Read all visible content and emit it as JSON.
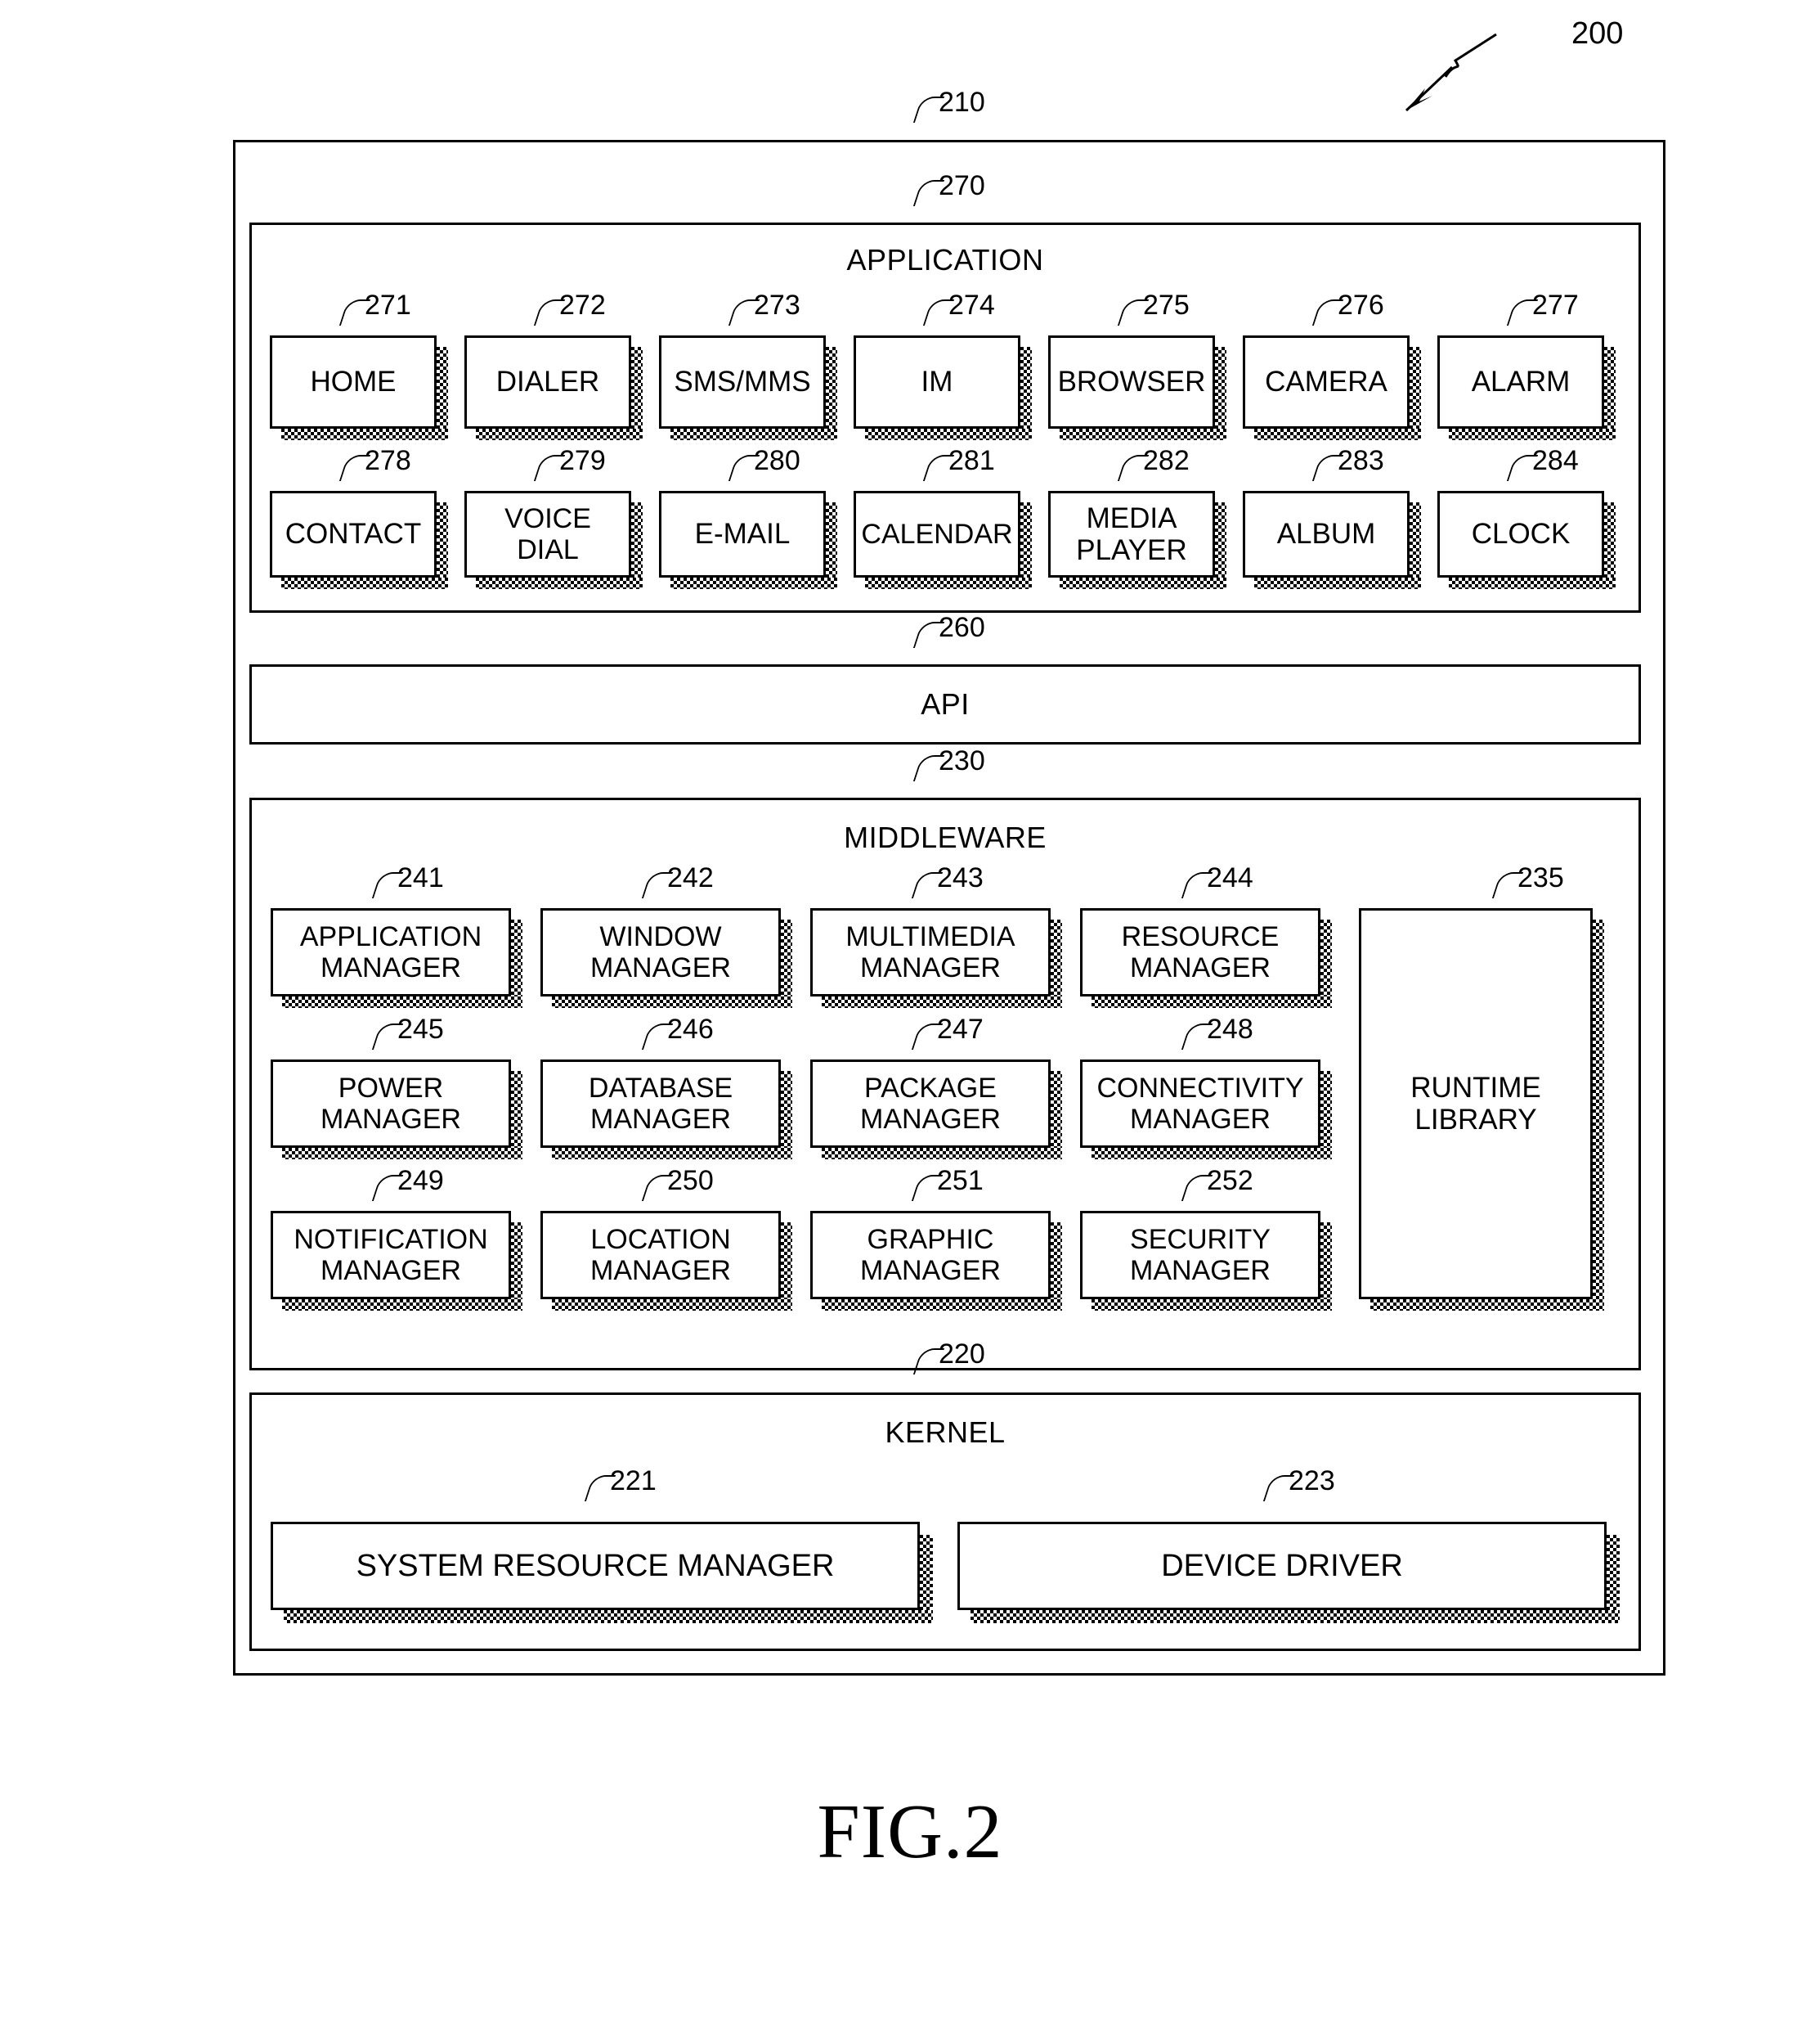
{
  "figure": {
    "caption": "FIG.2",
    "top_marker": "200"
  },
  "diagram": {
    "outer": {
      "ref": "210"
    },
    "layers": [
      {
        "id": "application-layer",
        "ref": "270",
        "title": "APPLICATION",
        "rows": [
          [
            {
              "ref": "271",
              "label": "HOME"
            },
            {
              "ref": "272",
              "label": "DIALER"
            },
            {
              "ref": "273",
              "label": "SMS/MMS"
            },
            {
              "ref": "274",
              "label": "IM"
            },
            {
              "ref": "275",
              "label": "BROWSER"
            },
            {
              "ref": "276",
              "label": "CAMERA"
            },
            {
              "ref": "277",
              "label": "ALARM"
            }
          ],
          [
            {
              "ref": "278",
              "label": "CONTACT"
            },
            {
              "ref": "279",
              "label": "VOICE DIAL"
            },
            {
              "ref": "280",
              "label": "E-MAIL"
            },
            {
              "ref": "281",
              "label": "CALENDAR"
            },
            {
              "ref": "282",
              "label": "MEDIA\nPLAYER"
            },
            {
              "ref": "283",
              "label": "ALBUM"
            },
            {
              "ref": "284",
              "label": "CLOCK"
            }
          ]
        ]
      },
      {
        "id": "api-layer",
        "ref": "260",
        "title": "API"
      },
      {
        "id": "middleware-layer",
        "ref": "230",
        "title": "MIDDLEWARE",
        "rows": [
          [
            {
              "ref": "241",
              "label": "APPLICATION\nMANAGER"
            },
            {
              "ref": "242",
              "label": "WINDOW\nMANAGER"
            },
            {
              "ref": "243",
              "label": "MULTIMEDIA\nMANAGER"
            },
            {
              "ref": "244",
              "label": "RESOURCE\nMANAGER"
            }
          ],
          [
            {
              "ref": "245",
              "label": "POWER\nMANAGER"
            },
            {
              "ref": "246",
              "label": "DATABASE\nMANAGER"
            },
            {
              "ref": "247",
              "label": "PACKAGE\nMANAGER"
            },
            {
              "ref": "248",
              "label": "CONNECTIVITY\nMANAGER"
            }
          ],
          [
            {
              "ref": "249",
              "label": "NOTIFICATION\nMANAGER"
            },
            {
              "ref": "250",
              "label": "LOCATION\nMANAGER"
            },
            {
              "ref": "251",
              "label": "GRAPHIC\nMANAGER"
            },
            {
              "ref": "252",
              "label": "SECURITY\nMANAGER"
            }
          ]
        ],
        "runtime": {
          "ref": "235",
          "label": "RUNTIME\nLIBRARY"
        }
      },
      {
        "id": "kernel-layer",
        "ref": "220",
        "title": "KERNEL",
        "rows": [
          [
            {
              "ref": "221",
              "label": "SYSTEM RESOURCE MANAGER"
            },
            {
              "ref": "223",
              "label": "DEVICE DRIVER"
            }
          ]
        ]
      }
    ]
  }
}
